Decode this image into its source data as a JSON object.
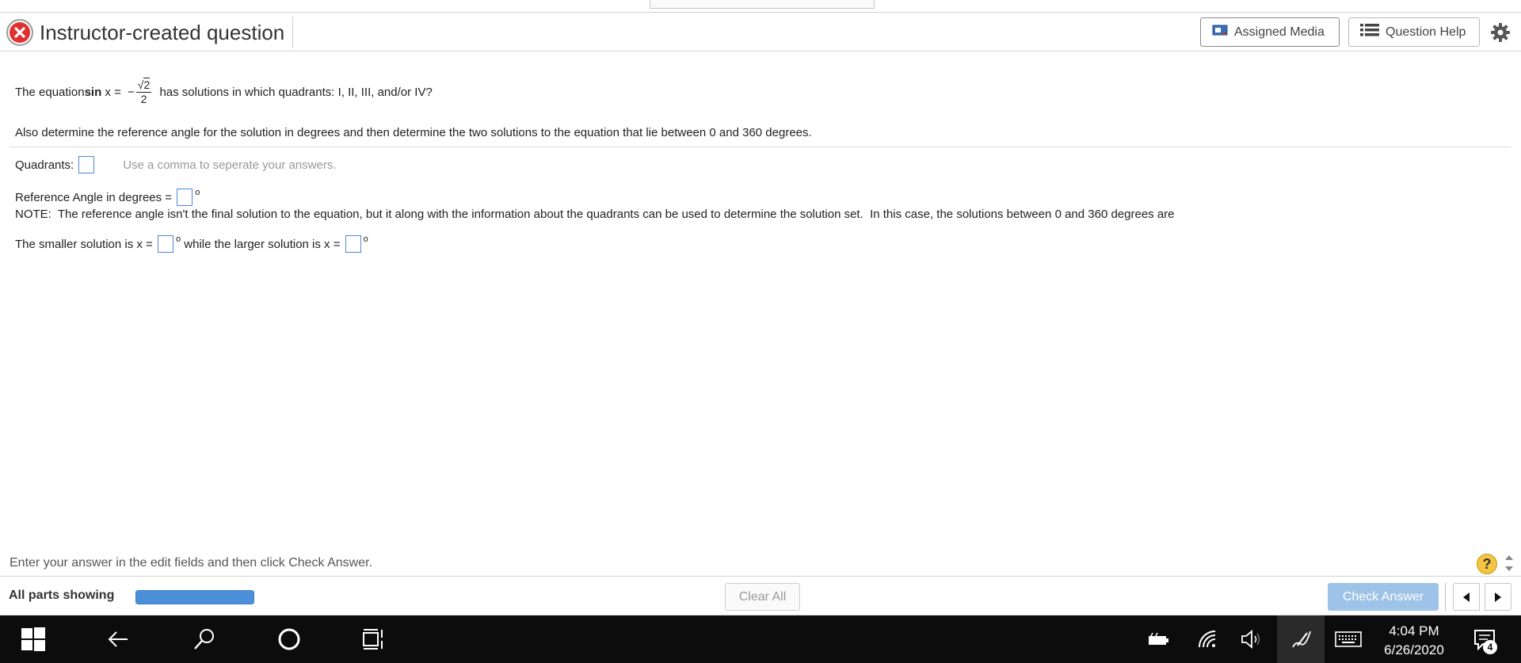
{
  "header": {
    "title": "Instructor-created question",
    "assigned_media_label": "Assigned Media",
    "question_help_label": "Question Help"
  },
  "question": {
    "prefix": "The equation ",
    "func": "sin",
    "var_eq": " x = ",
    "neg": "−",
    "sqrt_sign": "√",
    "radicand": "2",
    "denominator": "2",
    "suffix": " has solutions in which quadrants: I, II, III, and/or IV?",
    "line2": "Also determine the reference angle for the solution in degrees and then determine the two solutions to the equation that lie between 0 and 360 degrees.",
    "quadrants_label": "Quadrants:",
    "quadrants_hint": "Use a comma to seperate your answers.",
    "ref_angle_label": "Reference Angle in degrees = ",
    "degree_symbol": "o",
    "note": "NOTE:  The reference angle isn't the final solution to the equation, but it along with the information about the quadrants can be used to determine the solution set.  In this case, the solutions between 0 and 360 degrees are",
    "smaller_label": "The smaller solution is x = ",
    "larger_label": " while the larger solution is x = "
  },
  "instructions": {
    "text": "Enter your answer in the edit fields and then click Check Answer.",
    "help_symbol": "?"
  },
  "footer": {
    "parts_label": "All parts showing",
    "progress_fraction": 1.0,
    "clear_all_label": "Clear All",
    "check_answer_label": "Check Answer"
  },
  "taskbar": {
    "time": "4:04 PM",
    "date": "6/26/2020",
    "notification_count": "4"
  },
  "colors": {
    "close_red": "#e03131",
    "input_border": "#4c8ad6",
    "progress_fill": "#4a8fd8",
    "check_button_disabled": "#9ec3e8",
    "taskbar_bg": "#0c0c0c"
  }
}
